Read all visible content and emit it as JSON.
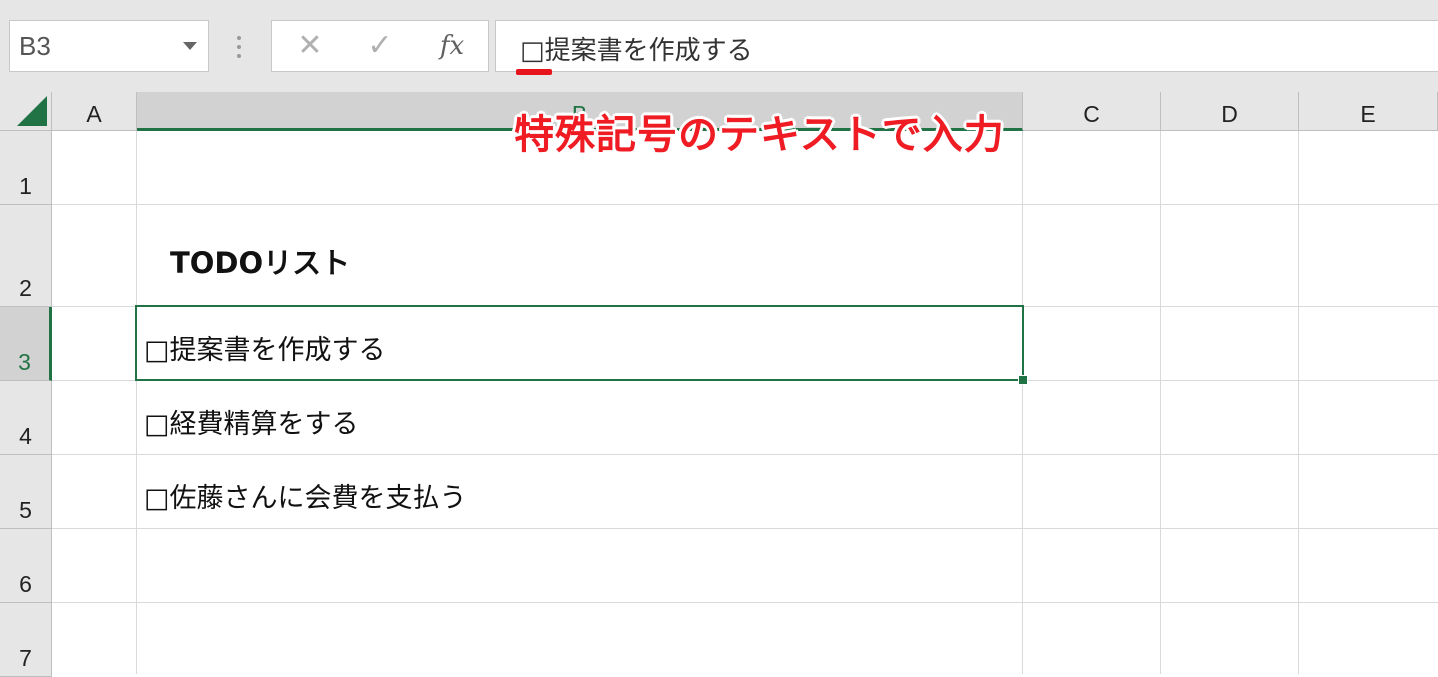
{
  "formula_bar": {
    "name_box": "B3",
    "cancel_icon": "cancel-icon",
    "confirm_icon": "check-icon",
    "fx_label": "fx",
    "formula": "□提案書を作成する"
  },
  "columns": [
    "A",
    "B",
    "C",
    "D",
    "E"
  ],
  "rows": [
    "1",
    "2",
    "3",
    "4",
    "5",
    "6",
    "7"
  ],
  "cells": {
    "title": "TODOリスト",
    "items": [
      "□提案書を作成する",
      "□経費精算をする",
      "□佐藤さんに会費を支払う"
    ]
  },
  "annotation": "特殊記号のテキストで入力",
  "colors": {
    "accent": "#217346",
    "annotation": "#ef1c24"
  }
}
